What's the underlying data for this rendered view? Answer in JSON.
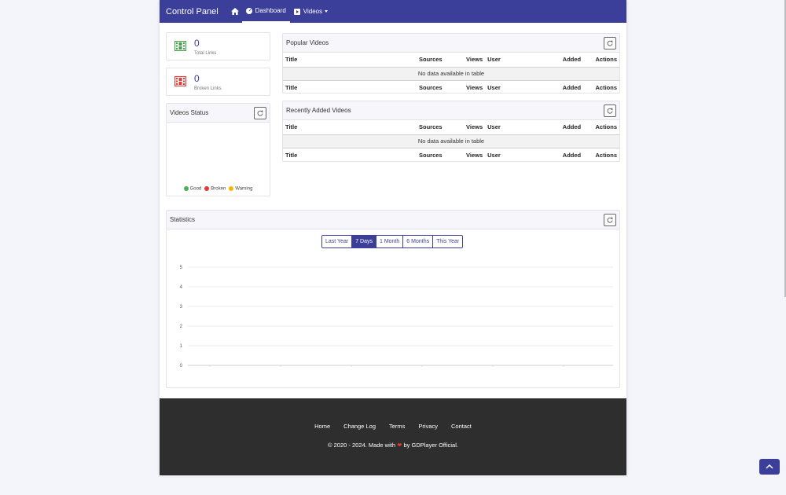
{
  "nav": {
    "brand": "Control Panel",
    "dashboard": "Dashboard",
    "videos": "Videos"
  },
  "stats": {
    "total_links": {
      "value": "0",
      "label": "Total Links"
    },
    "broken_links": {
      "value": "0",
      "label": "Broken Links"
    }
  },
  "videos_status": {
    "title": "Videos Status",
    "legend": [
      {
        "label": "Good",
        "color": "#4caf50"
      },
      {
        "label": "Broken",
        "color": "#e53935"
      },
      {
        "label": "Warning",
        "color": "#ffb300"
      }
    ]
  },
  "popular": {
    "title": "Popular Videos",
    "empty": "No data available in table"
  },
  "recent": {
    "title": "Recently Added Videos",
    "empty": "No data available in table"
  },
  "columns": {
    "title": "Title",
    "sources": "Sources",
    "views": "Views",
    "user": "User",
    "added": "Added",
    "actions": "Actions"
  },
  "statistics": {
    "title": "Statistics",
    "ranges": [
      "Last Year",
      "7 Days",
      "1 Month",
      "6 Months",
      "This Year"
    ],
    "active_range": "7 Days"
  },
  "chart_data": {
    "type": "line",
    "title": "",
    "xlabel": "",
    "ylabel": "",
    "ylim": [
      0,
      5
    ],
    "yticks": [
      "5",
      "4",
      "3",
      "2",
      "1",
      "0"
    ],
    "x": [],
    "series": []
  },
  "footer": {
    "links": [
      "Home",
      "Change Log",
      "Terms",
      "Privacy",
      "Contact"
    ],
    "copy_prefix": "© 2020 - 2024. Made with",
    "copy_suffix": "by GDPlayer Official."
  },
  "colors": {
    "accent": "#3b3f99",
    "footer": "#2e2e2e"
  }
}
